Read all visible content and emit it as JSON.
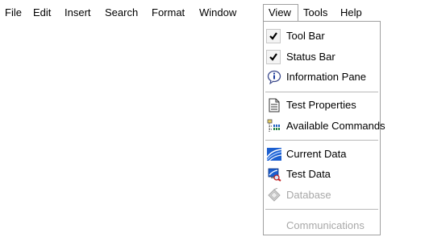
{
  "menubar": {
    "items": [
      "File",
      "Edit",
      "Insert",
      "Search",
      "Format",
      "Window",
      "View",
      "Tools",
      "Help"
    ],
    "active": "View"
  },
  "view_menu": {
    "items": [
      {
        "label": "Tool Bar",
        "icon": "check-icon",
        "checked": true,
        "enabled": true
      },
      {
        "label": "Status Bar",
        "icon": "check-icon",
        "checked": true,
        "enabled": true
      },
      {
        "label": "Information Pane",
        "icon": "info-icon",
        "checked": false,
        "enabled": true
      },
      {
        "label": "Test Properties",
        "icon": "document-icon",
        "checked": false,
        "enabled": true
      },
      {
        "label": "Available Commands",
        "icon": "command-tree-icon",
        "checked": false,
        "enabled": true
      },
      {
        "label": "Current Data",
        "icon": "current-data-icon",
        "checked": false,
        "enabled": true
      },
      {
        "label": "Test Data",
        "icon": "test-data-icon",
        "checked": false,
        "enabled": true
      },
      {
        "label": "Database",
        "icon": "database-icon",
        "checked": false,
        "enabled": false
      },
      {
        "label": "Communications",
        "icon": "",
        "checked": false,
        "enabled": false
      }
    ]
  }
}
